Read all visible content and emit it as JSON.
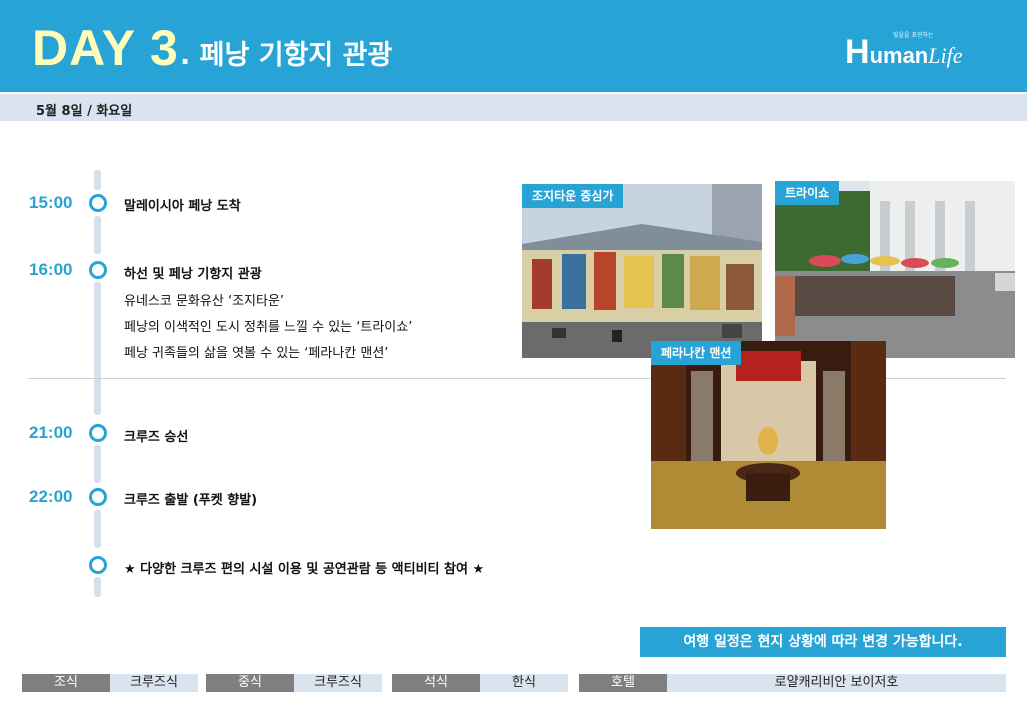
{
  "header": {
    "day_label": "DAY",
    "day_number": "3",
    "title": ". 페낭 기항지 관광",
    "logo_tagline": "빛을을 표현하는",
    "logo_h": "H",
    "logo_uman": "uman",
    "logo_life": "Life"
  },
  "date": "5월 8일 / 화요일",
  "timeline": [
    {
      "time": "15:00",
      "lines": [
        "말레이시아 페낭 도착"
      ]
    },
    {
      "time": "16:00",
      "lines": [
        "하선 및 페낭 기항지 관광",
        "유네스코 문화유산 ‘조지타운’",
        "페낭의 이색적인 도시 정취를 느낄 수 있는 ‘트라이쇼’",
        "페낭 귀족들의 삶을 엿볼 수 있는 ‘페라나칸 맨션’"
      ]
    },
    {
      "time": "21:00",
      "lines": [
        "크루즈 승선"
      ]
    },
    {
      "time": "22:00",
      "lines": [
        "크루즈 출발 (푸켓 향발)"
      ]
    },
    {
      "time": "",
      "lines": [
        "★ 다양한 크루즈 편의 시설 이용 및 공연관람 등 액티비티 참여 ★"
      ]
    }
  ],
  "photos": [
    {
      "caption": "조지타운 중심가"
    },
    {
      "caption": "트라이쇼"
    },
    {
      "caption": "페라나칸 맨션"
    }
  ],
  "notice": "여행 일정은 현지 상황에 따라 변경 가능합니다.",
  "meals": [
    {
      "label": "조식",
      "value": "크루즈식"
    },
    {
      "label": "중식",
      "value": "크루즈식"
    },
    {
      "label": "석식",
      "value": "한식"
    },
    {
      "label": "호텔",
      "value": "로얄캐리비안 보이저호"
    }
  ],
  "colors": {
    "accent": "#27a3d6",
    "day_text": "#fffdb8",
    "subbar": "#dae3f0",
    "meal_label_bg": "#7f7f7f"
  }
}
